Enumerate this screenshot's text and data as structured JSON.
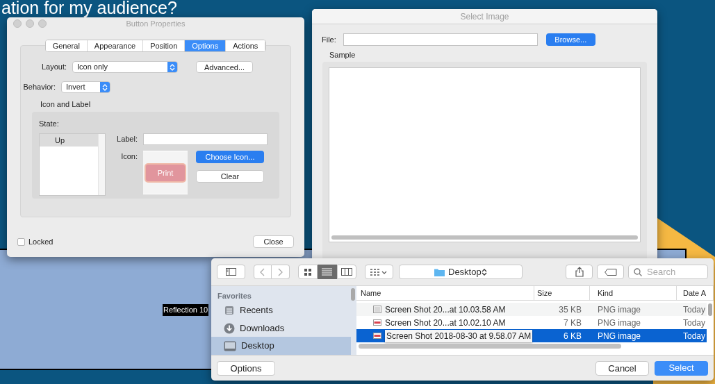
{
  "background": {
    "headline": "ation for my audience?",
    "shape_label": "Reflection 10"
  },
  "button_properties": {
    "title": "Button Properties",
    "tabs": [
      {
        "label": "General",
        "selected": false
      },
      {
        "label": "Appearance",
        "selected": false
      },
      {
        "label": "Position",
        "selected": false
      },
      {
        "label": "Options",
        "selected": true
      },
      {
        "label": "Actions",
        "selected": false
      }
    ],
    "layout": {
      "label": "Layout:",
      "value": "Icon only"
    },
    "advanced_button": "Advanced...",
    "behavior": {
      "label": "Behavior:",
      "value": "Invert"
    },
    "icon_and_label": {
      "title": "Icon and Label",
      "state_label": "State:",
      "states": [
        {
          "label": "Up",
          "selected": true
        }
      ],
      "label_field": {
        "label": "Label:"
      },
      "icon": {
        "label": "Icon:",
        "preview_text": "Print"
      },
      "choose_icon_button": "Choose Icon...",
      "clear_button": "Clear"
    },
    "locked": {
      "label": "Locked",
      "checked": false
    },
    "close_button": "Close"
  },
  "select_image": {
    "title": "Select Image",
    "file_label": "File:",
    "browse_button": "Browse...",
    "sample_label": "Sample"
  },
  "file_dialog": {
    "view_modes": [
      {
        "kind": "icons",
        "selected": false
      },
      {
        "kind": "list",
        "selected": true
      },
      {
        "kind": "columns",
        "selected": false
      }
    ],
    "location": "Desktop",
    "search": {
      "placeholder": "Search"
    },
    "sidebar": {
      "heading": "Favorites",
      "items": [
        {
          "kind": "recents",
          "label": "Recents",
          "selected": false
        },
        {
          "kind": "downloads",
          "label": "Downloads",
          "selected": false
        },
        {
          "kind": "desktop",
          "label": "Desktop",
          "selected": true
        }
      ]
    },
    "columns": [
      "Name",
      "Size",
      "Kind",
      "Date A"
    ],
    "rows": [
      {
        "name": "Screen Shot 20...at 10.03.58 AM",
        "size": "35 KB",
        "file_kind": "PNG image",
        "date": "Today",
        "kind": "plain",
        "selected": false
      },
      {
        "name": "Screen Shot 20...at 10.02.10 AM",
        "size": "7 KB",
        "file_kind": "PNG image",
        "date": "Today",
        "kind": "banner",
        "selected": false
      },
      {
        "name": "Screen Shot 2018-08-30 at 9.58.07 AM",
        "size": "6 KB",
        "file_kind": "PNG image",
        "date": "Today",
        "kind": "banner",
        "selected": true
      }
    ],
    "options_button": "Options",
    "cancel_button": "Cancel",
    "select_button": "Select"
  }
}
